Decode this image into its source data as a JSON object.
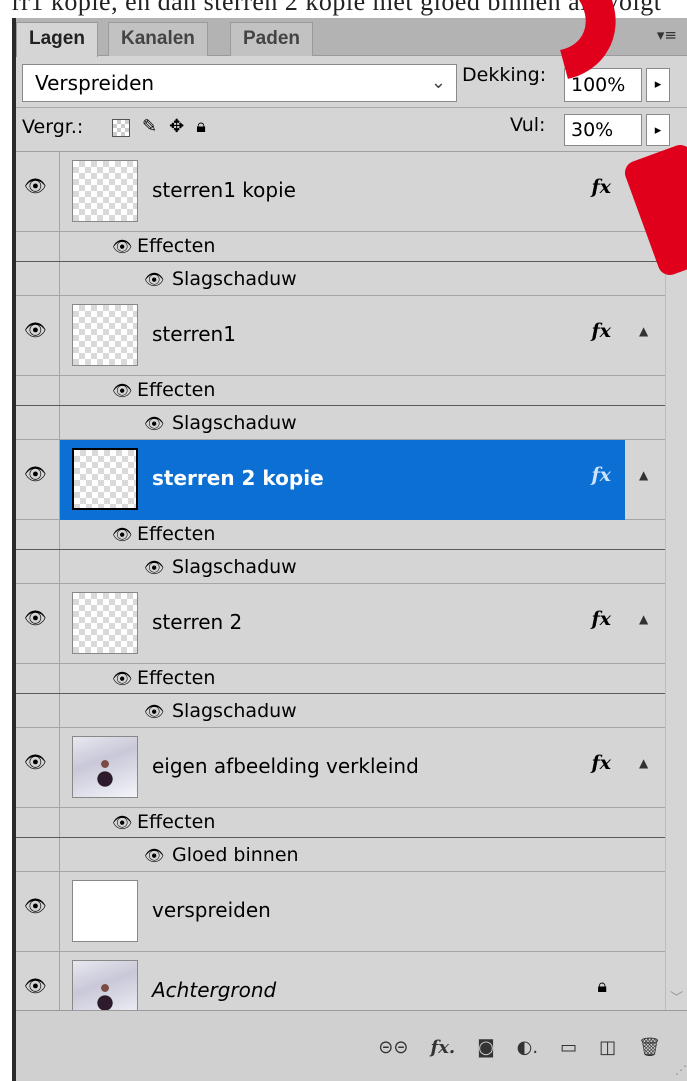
{
  "top_text": "rr1 kopie, en dan sterren 2 kopie met gloed binnen als volgt",
  "tabs": [
    "Lagen",
    "Kanalen",
    "Paden"
  ],
  "blend_mode": "Verspreiden",
  "opacity_label": "Dekking:",
  "opacity_value": "100%",
  "lock_label": "Vergr.:",
  "fill_label": "Vul:",
  "fill_value": "30%",
  "layers": [
    {
      "name": "sterren1 kopie",
      "fx": "fx",
      "effects_label": "Effecten",
      "effect": "Slagschaduw"
    },
    {
      "name": "sterren1",
      "fx": "fx",
      "effects_label": "Effecten",
      "effect": "Slagschaduw"
    },
    {
      "name": "sterren 2 kopie",
      "fx": "fx",
      "effects_label": "Effecten",
      "effect": "Slagschaduw"
    },
    {
      "name": "sterren 2",
      "fx": "fx",
      "effects_label": "Effecten",
      "effect": "Slagschaduw"
    },
    {
      "name": "eigen afbeelding verkleind",
      "fx": "fx",
      "effects_label": "Effecten",
      "effect": "Gloed binnen"
    },
    {
      "name": "verspreiden"
    },
    {
      "name": "Achtergrond"
    }
  ],
  "bottom_icons": [
    "link-icon",
    "fx-icon",
    "mask-icon",
    "adjustment-icon",
    "folder-icon",
    "new-layer-icon",
    "trash-icon"
  ],
  "selected_layer": "sterren 2 kopie",
  "colors": {
    "selection": "#0b6fd3",
    "panel": "#d5d5d5",
    "tabbar": "#b3b3b3",
    "watermark": "#e0001b"
  }
}
